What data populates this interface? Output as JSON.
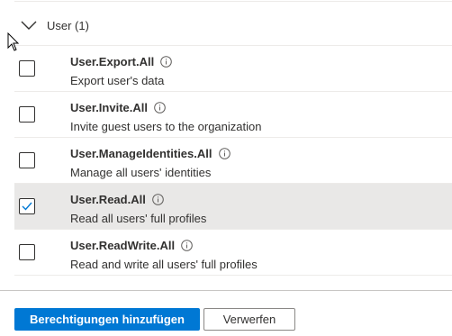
{
  "group": {
    "title": "User (1)",
    "expanded": true
  },
  "permissions": [
    {
      "name": "User.Export.All",
      "description": "Export user's data",
      "checked": false
    },
    {
      "name": "User.Invite.All",
      "description": "Invite guest users to the organization",
      "checked": false
    },
    {
      "name": "User.ManageIdentities.All",
      "description": "Manage all users' identities",
      "checked": false
    },
    {
      "name": "User.Read.All",
      "description": "Read all users' full profiles",
      "checked": true
    },
    {
      "name": "User.ReadWrite.All",
      "description": "Read and write all users' full profiles",
      "checked": false
    }
  ],
  "footer": {
    "add_permissions_label": "Berechtigungen hinzufügen",
    "discard_label": "Verwerfen"
  },
  "colors": {
    "accent": "#0078d4",
    "selected_row": "#e9e8e7"
  },
  "icons": {
    "chevron": "chevron-down-icon",
    "info": "info-icon",
    "check": "checkmark-icon",
    "cursor": "mouse-pointer-icon"
  }
}
